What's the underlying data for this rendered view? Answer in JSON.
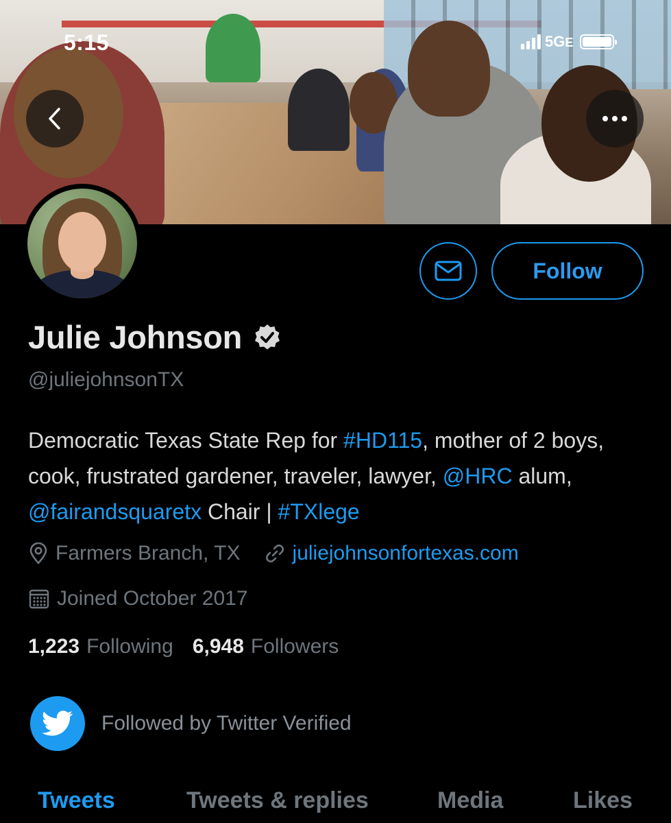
{
  "status_bar": {
    "time": "5:15",
    "network": "5G",
    "network_suffix": "E"
  },
  "nav": {
    "back_icon": "chevron-left-icon",
    "more_icon": "ellipsis-icon"
  },
  "profile": {
    "name": "Julie Johnson",
    "verified_icon": "verified-badge-icon",
    "handle": "@juliejohnsonTX",
    "bio": {
      "part1": "Democratic Texas State Rep for ",
      "hashtag1": "#HD115",
      "part2": ", mother of 2 boys, cook, frustrated gardener, traveler, lawyer, ",
      "mention1": "@HRC",
      "part3": " alum, ",
      "mention2": "@fairandsquaretx",
      "part4": " Chair | ",
      "hashtag2": "#TXlege"
    },
    "location": "Farmers Branch, TX",
    "website": "juliejohnsonfortexas.com",
    "joined": "Joined October 2017",
    "following_count": "1,223",
    "following_label": "Following",
    "followers_count": "6,948",
    "followers_label": "Followers",
    "followed_by": "Followed by Twitter Verified"
  },
  "actions": {
    "message_icon": "envelope-icon",
    "follow_label": "Follow"
  },
  "tabs": [
    {
      "label": "Tweets",
      "active": true
    },
    {
      "label": "Tweets & replies",
      "active": false
    },
    {
      "label": "Media",
      "active": false
    },
    {
      "label": "Likes",
      "active": false
    }
  ],
  "colors": {
    "accent": "#1d9bf0",
    "background": "#000000",
    "secondary_text": "#6e767d"
  }
}
